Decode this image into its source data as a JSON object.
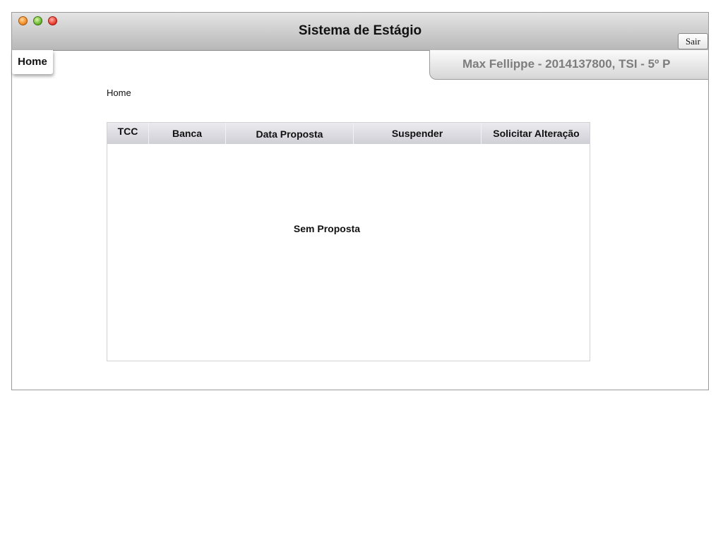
{
  "window": {
    "title": "Sistema de Estágio",
    "logout_label": "Sair"
  },
  "nav": {
    "home_tab_label": "Home"
  },
  "user": {
    "info": "Max Fellippe - 2014137800, TSI - 5º P"
  },
  "breadcrumb": "Home",
  "table": {
    "columns": [
      "TCC",
      "Banca",
      "Data Proposta",
      "Suspender",
      "Solicitar Alteração"
    ],
    "rows": [],
    "empty_message": "Sem Proposta"
  },
  "colors": {
    "titlebar": "#b7b7b7",
    "header_bg": "#cfcfd6",
    "user_text": "#7d7d7d"
  }
}
